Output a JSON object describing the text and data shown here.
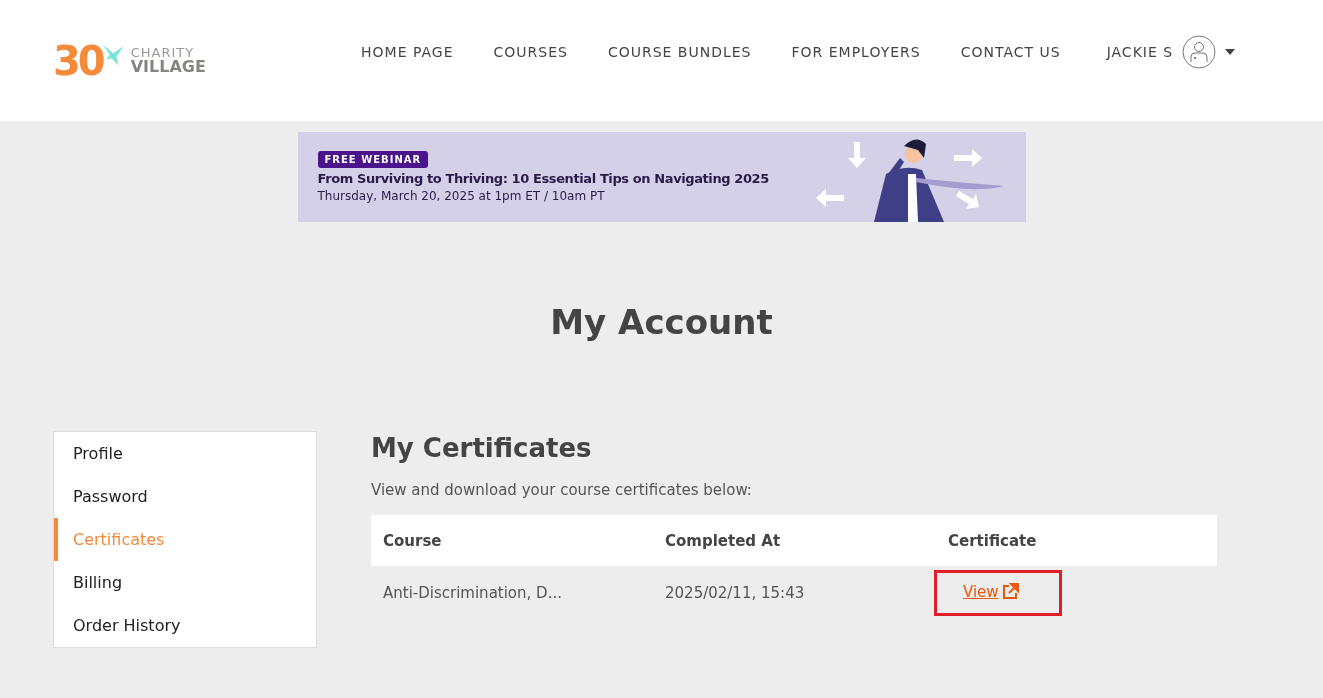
{
  "logo": {
    "number": "30",
    "line_1": "CHARITY",
    "line_2": "VILLAGE"
  },
  "nav": [
    {
      "label": "HOME PAGE"
    },
    {
      "label": "COURSES"
    },
    {
      "label": "COURSE BUNDLES"
    },
    {
      "label": "FOR EMPLOYERS"
    },
    {
      "label": "CONTACT US"
    }
  ],
  "user": {
    "name": "JACKIE S"
  },
  "banner": {
    "badge": "FREE WEBINAR",
    "title": "From Surviving to Thriving: 10 Essential Tips on Navigating 2025",
    "date": "Thursday, March 20, 2025 at 1pm ET / 10am PT"
  },
  "page_title": "My Account",
  "sidebar": {
    "items": [
      {
        "label": "Profile",
        "selected": false
      },
      {
        "label": "Password",
        "selected": false
      },
      {
        "label": "Certificates",
        "selected": true
      },
      {
        "label": "Billing",
        "selected": false
      },
      {
        "label": "Order History",
        "selected": false
      }
    ]
  },
  "section": {
    "title": "My Certificates",
    "description": "View and download your course certificates below:"
  },
  "table": {
    "columns": [
      "Course",
      "Completed At",
      "Certificate"
    ],
    "rows": [
      {
        "course": "Anti-Discrimination, D...",
        "completed_at": "2025/02/11, 15:43",
        "certificate": "View",
        "highlighted": true
      }
    ]
  }
}
